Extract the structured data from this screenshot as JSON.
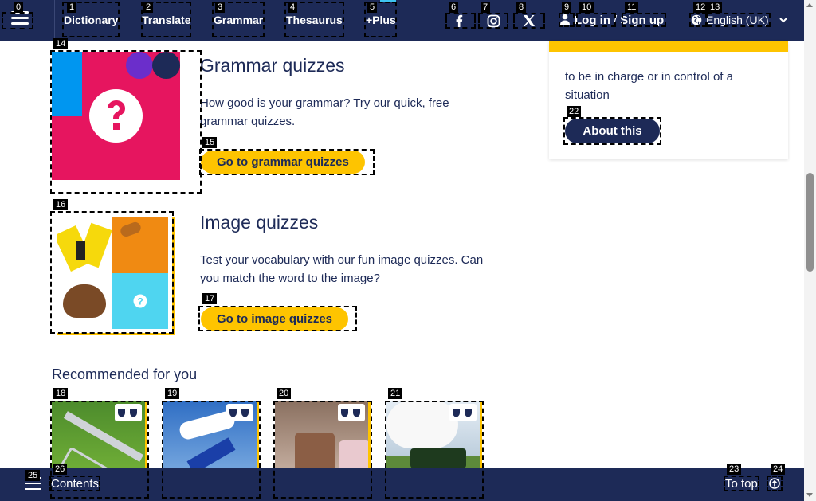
{
  "nav": {
    "items": [
      "Dictionary",
      "Translate",
      "Grammar",
      "Thesaurus",
      "+Plus"
    ],
    "login": "Log in",
    "signup": "Sign up",
    "slash": "/",
    "language": "English (UK)"
  },
  "grammar_quiz": {
    "title": "Grammar quizzes",
    "desc": "How good is your grammar? Try our quick, free grammar quizzes.",
    "button": "Go to grammar quizzes"
  },
  "image_quiz": {
    "title": "Image quizzes",
    "desc": "Test your vocabulary with our fun image quizzes. Can you match the word to the image?",
    "button": "Go to image quizzes"
  },
  "side": {
    "definition": "to be in charge or in control of a situation",
    "button": "About this"
  },
  "recommended": {
    "title": "Recommended for you"
  },
  "bottom": {
    "contents": "Contents",
    "to_top": "To top"
  },
  "labels": [
    "0",
    "1",
    "2",
    "3",
    "4",
    "5",
    "6",
    "7",
    "8",
    "9",
    "10",
    "11",
    "12",
    "13",
    "14",
    "15",
    "16",
    "17",
    "18",
    "19",
    "20",
    "21",
    "22",
    "23",
    "24",
    "25",
    "26"
  ],
  "colors": {
    "navy": "#1d2a57",
    "yellow": "#fec400",
    "cyan": "#3ec4f0"
  }
}
